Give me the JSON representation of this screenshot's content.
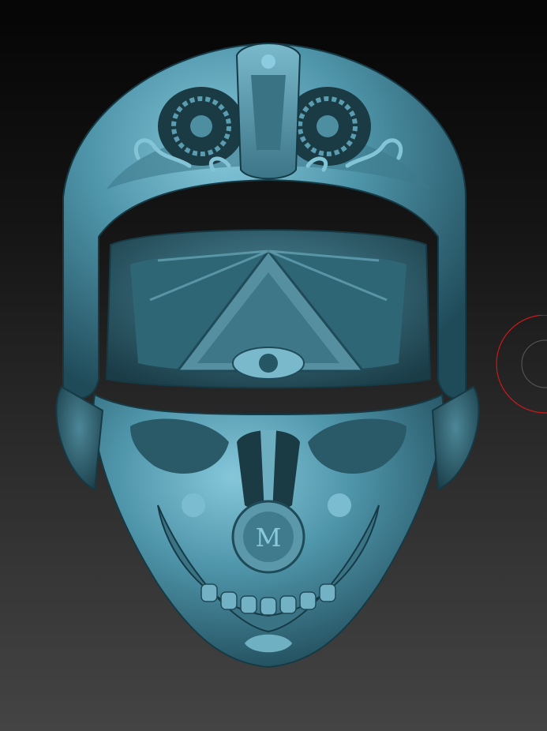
{
  "scene": {
    "subject": "sculpted-skull-mask-model",
    "colors": {
      "background_top": "#050505",
      "background_bottom": "#444444",
      "material_base": "#4a8ea3",
      "material_light": "#7fc2d6",
      "material_dark": "#1f4a58",
      "brush_cursor": "#cc1a1a"
    }
  }
}
